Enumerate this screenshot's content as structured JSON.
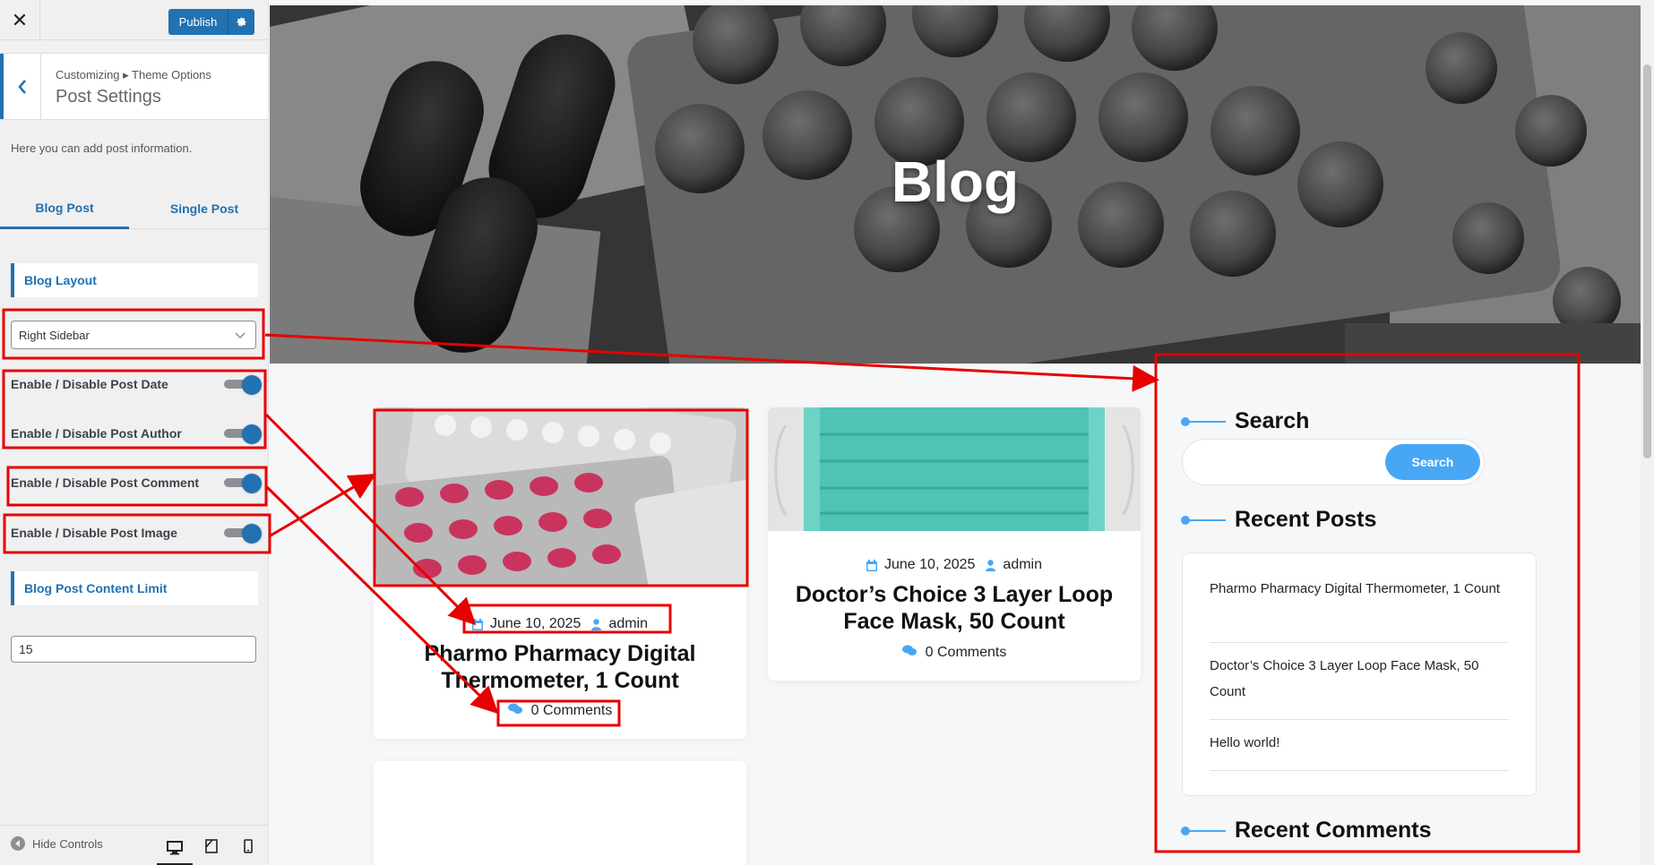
{
  "customizer": {
    "close_icon": "close-icon",
    "publish_label": "Publish",
    "breadcrumb": "Customizing ▸ Theme Options",
    "section_title": "Post Settings",
    "description": "Here you can add post information.",
    "tabs": [
      {
        "label": "Blog Post",
        "active": true
      },
      {
        "label": "Single Post",
        "active": false
      }
    ],
    "blog_layout_heading": "Blog Layout",
    "blog_layout_value": "Right Sidebar",
    "toggles": [
      {
        "label": "Enable / Disable Post Date",
        "on": true
      },
      {
        "label": "Enable / Disable Post Author",
        "on": true
      },
      {
        "label": "Enable / Disable Post Comment",
        "on": true
      },
      {
        "label": "Enable / Disable Post Image",
        "on": true
      }
    ],
    "content_limit_heading": "Blog Post Content Limit",
    "content_limit_value": "15",
    "hide_controls": "Hide Controls",
    "accent_color": "#2271b1"
  },
  "preview": {
    "hero_title": "Blog",
    "posts": [
      {
        "date": "June 10, 2025",
        "author": "admin",
        "title": "Pharmo Pharmacy Digital Thermometer, 1 Count",
        "comments": "0 Comments"
      },
      {
        "date": "June 10, 2025",
        "author": "admin",
        "title": "Doctor’s Choice 3 Layer Loop Face Mask, 50 Count",
        "comments": "0 Comments"
      }
    ],
    "widgets": {
      "search_title": "Search",
      "search_button": "Search",
      "recent_posts_title": "Recent Posts",
      "recent_posts": [
        "Pharmo Pharmacy Digital Thermometer, 1 Count",
        "Doctor’s Choice 3 Layer Loop Face Mask, 50 Count",
        "Hello world!"
      ],
      "recent_comments_title": "Recent Comments"
    },
    "accent_color": "#47a7f5",
    "annotation_color": "#e60000"
  }
}
